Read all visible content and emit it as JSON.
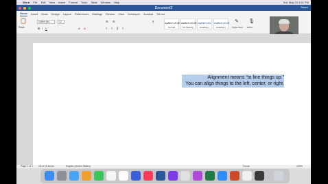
{
  "menubar": {
    "app": "Word",
    "items": [
      "File",
      "Edit",
      "View",
      "Insert",
      "Format",
      "Tools",
      "Table",
      "Window",
      "Help"
    ],
    "clock": "Sun May 22 4:51 PM"
  },
  "window": {
    "title": "Document2",
    "share": "Share",
    "comments": "Comments"
  },
  "tabs": [
    "Home",
    "Insert",
    "Draw",
    "Design",
    "Layout",
    "References",
    "Mailings",
    "Review",
    "View",
    "Developer",
    "Acrobat",
    "Tell me"
  ],
  "ribbon": {
    "paste": "Paste",
    "font": "Calibri (Bo...",
    "size": "12",
    "styles": [
      {
        "sample": "AaBbCcDdEe",
        "name": "Normal"
      },
      {
        "sample": "AaBbCcDdEe",
        "name": "No Spacing"
      },
      {
        "sample": "AaBbCcDc",
        "name": "Heading 1"
      },
      {
        "sample": "AaBbCcDdE",
        "name": "Heading 2"
      }
    ],
    "styles_pane": "Styles Pane",
    "dictate": "Dictat"
  },
  "webcam": {
    "caption": "Chantel Isoto (OneyShanti)"
  },
  "document": {
    "lines": [
      "Alignment means “to line things up.”",
      "You can align things to the left, center, or right."
    ]
  },
  "status": {
    "page": "Page 1 of 1",
    "words": "18 of 18 words",
    "language": "English (United States)",
    "focus": "Focus",
    "zoom": "235%"
  },
  "colors": {
    "word_blue": "#2b579a",
    "selection": "#b5cdec"
  }
}
